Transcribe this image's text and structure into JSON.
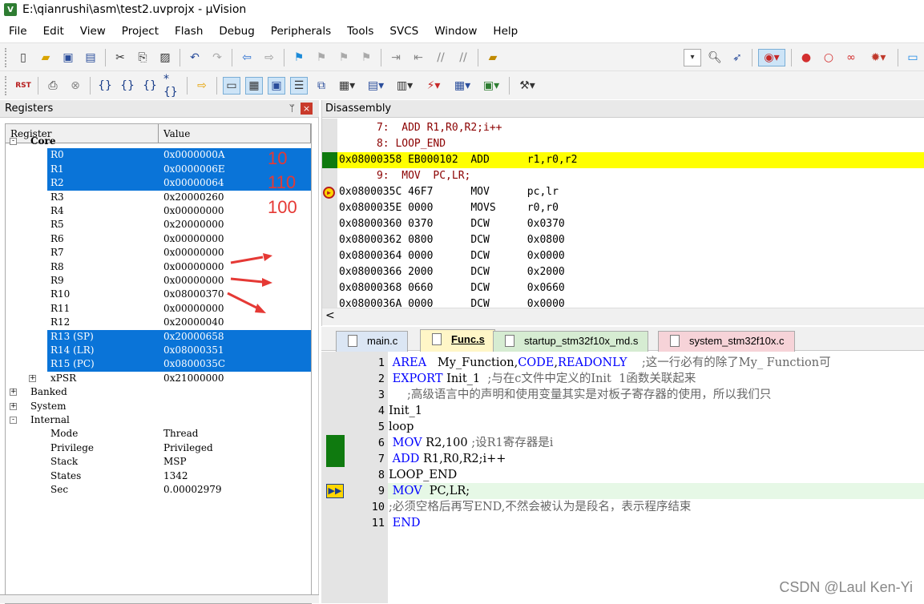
{
  "window": {
    "title": "E:\\qianrushi\\asm\\test2.uvprojx - µVision"
  },
  "menu": [
    "File",
    "Edit",
    "View",
    "Project",
    "Flash",
    "Debug",
    "Peripherals",
    "Tools",
    "SVCS",
    "Window",
    "Help"
  ],
  "toolbar_debug_label": "RST",
  "registers": {
    "panel_title": "Registers",
    "pin_glyph": "ᛘ",
    "close_glyph": "×",
    "col_register": "Register",
    "col_value": "Value",
    "rows": [
      {
        "label": "Core",
        "value": "",
        "tree": "-",
        "indent": 0,
        "selected": false,
        "bold": true
      },
      {
        "label": "R0",
        "value": "0x0000000A",
        "indent": 1,
        "selected": true
      },
      {
        "label": "R1",
        "value": "0x0000006E",
        "indent": 1,
        "selected": true
      },
      {
        "label": "R2",
        "value": "0x00000064",
        "indent": 1,
        "selected": true
      },
      {
        "label": "R3",
        "value": "0x20000260",
        "indent": 1,
        "selected": false
      },
      {
        "label": "R4",
        "value": "0x00000000",
        "indent": 1,
        "selected": false
      },
      {
        "label": "R5",
        "value": "0x20000000",
        "indent": 1,
        "selected": false
      },
      {
        "label": "R6",
        "value": "0x00000000",
        "indent": 1,
        "selected": false
      },
      {
        "label": "R7",
        "value": "0x00000000",
        "indent": 1,
        "selected": false
      },
      {
        "label": "R8",
        "value": "0x00000000",
        "indent": 1,
        "selected": false
      },
      {
        "label": "R9",
        "value": "0x00000000",
        "indent": 1,
        "selected": false
      },
      {
        "label": "R10",
        "value": "0x08000370",
        "indent": 1,
        "selected": false
      },
      {
        "label": "R11",
        "value": "0x00000000",
        "indent": 1,
        "selected": false
      },
      {
        "label": "R12",
        "value": "0x20000040",
        "indent": 1,
        "selected": false
      },
      {
        "label": "R13 (SP)",
        "value": "0x20000658",
        "indent": 1,
        "selected": true
      },
      {
        "label": "R14 (LR)",
        "value": "0x08000351",
        "indent": 1,
        "selected": true
      },
      {
        "label": "R15 (PC)",
        "value": "0x0800035C",
        "indent": 1,
        "selected": true
      },
      {
        "label": "xPSR",
        "value": "0x21000000",
        "tree": "+",
        "indent": 1,
        "selected": false
      },
      {
        "label": "Banked",
        "value": "",
        "tree": "+",
        "indent": 0,
        "selected": false
      },
      {
        "label": "System",
        "value": "",
        "tree": "+",
        "indent": 0,
        "selected": false
      },
      {
        "label": "Internal",
        "value": "",
        "tree": "-",
        "indent": 0,
        "selected": false
      },
      {
        "label": "Mode",
        "value": "Thread",
        "indent": 1,
        "selected": false
      },
      {
        "label": "Privilege",
        "value": "Privileged",
        "indent": 1,
        "selected": false
      },
      {
        "label": "Stack",
        "value": "MSP",
        "indent": 1,
        "selected": false
      },
      {
        "label": "States",
        "value": "1342",
        "indent": 1,
        "selected": false
      },
      {
        "label": "Sec",
        "value": "0.00002979",
        "indent": 1,
        "selected": false
      }
    ],
    "annotations": [
      "10",
      "110",
      "100"
    ],
    "annotation_color": "#e53935"
  },
  "disassembly": {
    "title": "Disassembly",
    "scroll_left_glyph": "<",
    "lines": [
      {
        "text": "      7:  ADD R1,R0,R2;i++",
        "type": "src"
      },
      {
        "text": "      8: LOOP_END",
        "type": "src"
      },
      {
        "text": "0x08000358 EB000102  ADD      r1,r0,r2",
        "type": "asm",
        "highlight": true
      },
      {
        "text": "      9:  MOV  PC,LR;",
        "type": "src"
      },
      {
        "text": "0x0800035C 46F7      MOV      pc,lr",
        "type": "asm",
        "pcmark": true
      },
      {
        "text": "0x0800035E 0000      MOVS     r0,r0",
        "type": "asm"
      },
      {
        "text": "0x08000360 0370      DCW      0x0370",
        "type": "asm"
      },
      {
        "text": "0x08000362 0800      DCW      0x0800",
        "type": "asm"
      },
      {
        "text": "0x08000364 0000      DCW      0x0000",
        "type": "asm"
      },
      {
        "text": "0x08000366 2000      DCW      0x2000",
        "type": "asm"
      },
      {
        "text": "0x08000368 0660      DCW      0x0660",
        "type": "asm"
      },
      {
        "text": "0x0800036A 0000      DCW      0x0000",
        "type": "asm"
      }
    ]
  },
  "tabs": [
    {
      "label": "main.c",
      "bg": "#dbe6f4",
      "active": false
    },
    {
      "label": "Func.s",
      "bg": "#fff6c7",
      "active": true
    },
    {
      "label": "startup_stm32f10x_md.s",
      "bg": "#d6ecd2",
      "active": false
    },
    {
      "label": "system_stm32f10x.c",
      "bg": "#f6d3d8",
      "active": false
    }
  ],
  "editor": {
    "lines": [
      {
        "n": "1",
        "segs": [
          {
            "t": " AREA",
            "c": "kw"
          },
          {
            "t": "   My_Function,",
            "c": ""
          },
          {
            "t": "CODE",
            "c": "kw"
          },
          {
            "t": ",",
            "c": ""
          },
          {
            "t": "READONLY",
            "c": "kw"
          },
          {
            "t": "    ;这一行必有的除了My_ Function可",
            "c": "cm"
          }
        ]
      },
      {
        "n": "2",
        "segs": [
          {
            "t": " EXPORT",
            "c": "kw"
          },
          {
            "t": " Init_1  ",
            "c": ""
          },
          {
            "t": ";与在c文件中定义的Init  1函数关联起来",
            "c": "cm"
          }
        ]
      },
      {
        "n": "3",
        "segs": [
          {
            "t": "     ;高级语言中的声明和使用变量其实是对板子寄存器的使用，所以我们只",
            "c": "cm"
          }
        ]
      },
      {
        "n": "4",
        "segs": [
          {
            "t": "Init_1",
            "c": ""
          }
        ]
      },
      {
        "n": "5",
        "segs": [
          {
            "t": "loop",
            "c": ""
          }
        ]
      },
      {
        "n": "6",
        "segs": [
          {
            "t": " MOV",
            "c": "kw"
          },
          {
            "t": " R2,100 ",
            "c": ""
          },
          {
            "t": ";设R1寄存器是i",
            "c": "cm"
          }
        ],
        "bp": true
      },
      {
        "n": "7",
        "segs": [
          {
            "t": " ADD",
            "c": "kw"
          },
          {
            "t": " R1,R0,R2;i++",
            "c": ""
          }
        ],
        "bp": true
      },
      {
        "n": "8",
        "segs": [
          {
            "t": "LOOP_END",
            "c": ""
          }
        ]
      },
      {
        "n": "9",
        "segs": [
          {
            "t": " MOV",
            "c": "kw"
          },
          {
            "t": "  PC,LR;",
            "c": ""
          }
        ],
        "current": true
      },
      {
        "n": "10",
        "segs": [
          {
            "t": ";必须空格后再写END,不然会被认为是段名，表示程序结束",
            "c": "cm"
          }
        ]
      },
      {
        "n": "11",
        "segs": [
          {
            "t": " END",
            "c": "kw"
          }
        ]
      }
    ]
  },
  "watermark": "CSDN @Laul Ken-Yi",
  "colors": {
    "selection": "#0a74d8",
    "exec_highlight": "#ffff00",
    "breakpoint": "#0f7a0f",
    "keyword": "#0000ff"
  }
}
